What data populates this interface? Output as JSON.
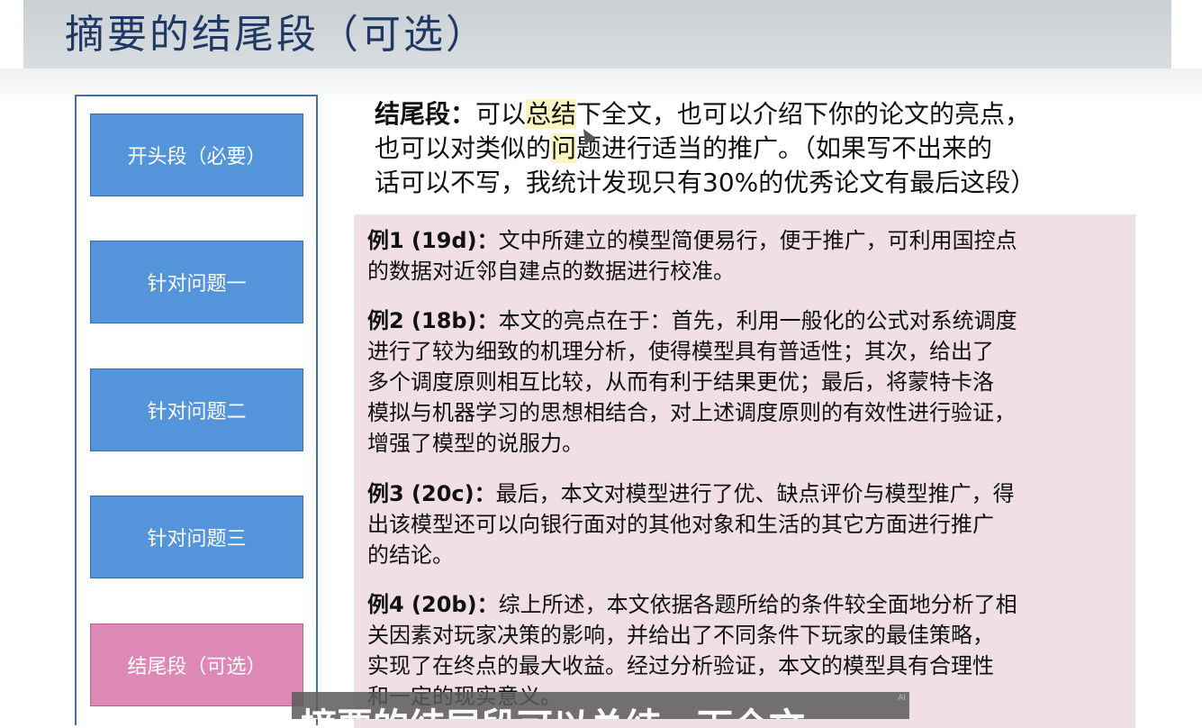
{
  "slide": {
    "title": "摘要的结尾段（可选）"
  },
  "sidebar": {
    "items": [
      {
        "label": "开头段（必要）"
      },
      {
        "label": "针对问题一"
      },
      {
        "label": "针对问题二"
      },
      {
        "label": "针对问题三"
      },
      {
        "label": "结尾段（可选）"
      }
    ]
  },
  "intro": {
    "label": "结尾段：",
    "line1_a": "可以",
    "line1_hl": "总结",
    "line1_b": "下全文，也可以介绍下你的论文的亮点，",
    "line2_a": "也可以对类似的",
    "line2_hl": "问",
    "line2_b": "题进行适当的推广。（如果写不出来的",
    "line3": "话可以不写，我统计发现只有30%的优秀论文有最后这段）"
  },
  "examples": [
    {
      "label": "例1 (19d)：",
      "lines": [
        "文中所建立的模型简便易行，便于推广，可利用国控点",
        "的数据对近邻自建点的数据进行校准。"
      ]
    },
    {
      "label": "例2 (18b)：",
      "lines": [
        "本文的亮点在于：首先，利用一般化的公式对系统调度",
        "进行了较为细致的机理分析，使得模型具有普适性；其次，给出了",
        "多个调度原则相互比较，从而有利于结果更优；最后，将蒙特卡洛",
        "模拟与机器学习的思想相结合，对上述调度原则的有效性进行验证，",
        "增强了模型的说服力。"
      ]
    },
    {
      "label": "例3 (20c)：",
      "lines": [
        "最后，本文对模型进行了优、缺点评价与模型推广，得",
        "出该模型还可以向银行面对的其他对象和生活的其它方面进行推广",
        "的结论。"
      ]
    },
    {
      "label": "例4 (20b)：",
      "lines": [
        "综上所述，本文依据各题所给的条件较全面地分析了相",
        "关因素对玩家决策的影响，并给出了不同条件下玩家的最佳策略，",
        "实现了在终点的最大收益。经过分析验证，本文的模型具有合理性",
        "和一定的现实意义。"
      ]
    }
  ],
  "subtitle": {
    "text": "摘要的结尾段可以总结一下全文",
    "mark": "AI"
  },
  "colors": {
    "title": "#1f3864",
    "sidebar_button": "#5494db",
    "sidebar_active": "#dd88b6",
    "examples_bg": "#f0e0e6",
    "highlight": "#faf4c0"
  }
}
